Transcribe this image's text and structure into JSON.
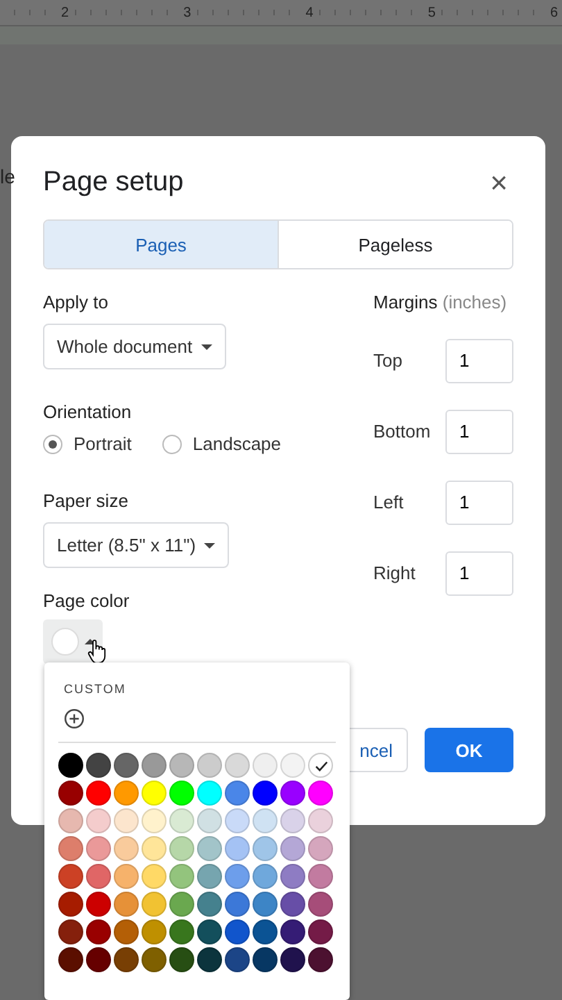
{
  "ruler": {
    "numbers": [
      "2",
      "3",
      "4",
      "5",
      "6"
    ]
  },
  "edge_text": "le",
  "dialog": {
    "title": "Page setup",
    "close": "×",
    "tabs": [
      {
        "label": "Pages",
        "selected": true
      },
      {
        "label": "Pageless",
        "selected": false
      }
    ],
    "apply_to": {
      "label": "Apply to",
      "value": "Whole document"
    },
    "orientation": {
      "label": "Orientation",
      "options": [
        {
          "label": "Portrait",
          "selected": true
        },
        {
          "label": "Landscape",
          "selected": false
        }
      ]
    },
    "paper_size": {
      "label": "Paper size",
      "value": "Letter (8.5\" x 11\")"
    },
    "page_color": {
      "label": "Page color",
      "color": "#ffffff"
    },
    "margins": {
      "label": "Margins",
      "unit": "(inches)",
      "fields": [
        {
          "label": "Top",
          "value": "1"
        },
        {
          "label": "Bottom",
          "value": "1"
        },
        {
          "label": "Left",
          "value": "1"
        },
        {
          "label": "Right",
          "value": "1"
        }
      ]
    },
    "buttons": {
      "cancel": "ncel",
      "ok": "OK"
    }
  },
  "color_menu": {
    "custom_label": "CUSTOM",
    "rows": [
      [
        {
          "color": "#000000",
          "selected": false
        },
        {
          "color": "#434343",
          "selected": false
        },
        {
          "color": "#666666",
          "selected": false
        },
        {
          "color": "#999999",
          "selected": false
        },
        {
          "color": "#b7b7b7",
          "selected": false
        },
        {
          "color": "#cccccc",
          "selected": false
        },
        {
          "color": "#d9d9d9",
          "selected": false
        },
        {
          "color": "#efefef",
          "selected": false
        },
        {
          "color": "#f3f3f3",
          "selected": false
        },
        {
          "color": "#ffffff",
          "selected": true
        }
      ],
      [
        {
          "color": "#980000",
          "selected": false
        },
        {
          "color": "#ff0000",
          "selected": false
        },
        {
          "color": "#ff9900",
          "selected": false
        },
        {
          "color": "#ffff00",
          "selected": false
        },
        {
          "color": "#00ff00",
          "selected": false
        },
        {
          "color": "#00ffff",
          "selected": false
        },
        {
          "color": "#4a86e8",
          "selected": false
        },
        {
          "color": "#0000ff",
          "selected": false
        },
        {
          "color": "#9900ff",
          "selected": false
        },
        {
          "color": "#ff00ff",
          "selected": false
        }
      ],
      [
        {
          "color": "#e6b8af",
          "selected": false
        },
        {
          "color": "#f4cccc",
          "selected": false
        },
        {
          "color": "#fce5cd",
          "selected": false
        },
        {
          "color": "#fff2cc",
          "selected": false
        },
        {
          "color": "#d9ead3",
          "selected": false
        },
        {
          "color": "#d0e0e3",
          "selected": false
        },
        {
          "color": "#c9daf8",
          "selected": false
        },
        {
          "color": "#cfe2f3",
          "selected": false
        },
        {
          "color": "#d9d2e9",
          "selected": false
        },
        {
          "color": "#ead1dc",
          "selected": false
        }
      ],
      [
        {
          "color": "#dd7e6b",
          "selected": false
        },
        {
          "color": "#ea9999",
          "selected": false
        },
        {
          "color": "#f9cb9c",
          "selected": false
        },
        {
          "color": "#ffe599",
          "selected": false
        },
        {
          "color": "#b6d7a8",
          "selected": false
        },
        {
          "color": "#a2c4c9",
          "selected": false
        },
        {
          "color": "#a4c2f4",
          "selected": false
        },
        {
          "color": "#9fc5e8",
          "selected": false
        },
        {
          "color": "#b4a7d6",
          "selected": false
        },
        {
          "color": "#d5a6bd",
          "selected": false
        }
      ],
      [
        {
          "color": "#cc4125",
          "selected": false
        },
        {
          "color": "#e06666",
          "selected": false
        },
        {
          "color": "#f6b26b",
          "selected": false
        },
        {
          "color": "#ffd966",
          "selected": false
        },
        {
          "color": "#93c47d",
          "selected": false
        },
        {
          "color": "#76a5af",
          "selected": false
        },
        {
          "color": "#6d9eeb",
          "selected": false
        },
        {
          "color": "#6fa8dc",
          "selected": false
        },
        {
          "color": "#8e7cc3",
          "selected": false
        },
        {
          "color": "#c27ba0",
          "selected": false
        }
      ],
      [
        {
          "color": "#a61c00",
          "selected": false
        },
        {
          "color": "#cc0000",
          "selected": false
        },
        {
          "color": "#e69138",
          "selected": false
        },
        {
          "color": "#f1c232",
          "selected": false
        },
        {
          "color": "#6aa84f",
          "selected": false
        },
        {
          "color": "#45818e",
          "selected": false
        },
        {
          "color": "#3c78d8",
          "selected": false
        },
        {
          "color": "#3d85c6",
          "selected": false
        },
        {
          "color": "#674ea7",
          "selected": false
        },
        {
          "color": "#a64d79",
          "selected": false
        }
      ],
      [
        {
          "color": "#85200c",
          "selected": false
        },
        {
          "color": "#990000",
          "selected": false
        },
        {
          "color": "#b45f06",
          "selected": false
        },
        {
          "color": "#bf9000",
          "selected": false
        },
        {
          "color": "#38761d",
          "selected": false
        },
        {
          "color": "#134f5c",
          "selected": false
        },
        {
          "color": "#1155cc",
          "selected": false
        },
        {
          "color": "#0b5394",
          "selected": false
        },
        {
          "color": "#351c75",
          "selected": false
        },
        {
          "color": "#741b47",
          "selected": false
        }
      ],
      [
        {
          "color": "#5b0f00",
          "selected": false
        },
        {
          "color": "#660000",
          "selected": false
        },
        {
          "color": "#783f04",
          "selected": false
        },
        {
          "color": "#7f6000",
          "selected": false
        },
        {
          "color": "#274e13",
          "selected": false
        },
        {
          "color": "#0c343d",
          "selected": false
        },
        {
          "color": "#1c4587",
          "selected": false
        },
        {
          "color": "#073763",
          "selected": false
        },
        {
          "color": "#20124d",
          "selected": false
        },
        {
          "color": "#4c1130",
          "selected": false
        }
      ]
    ]
  }
}
